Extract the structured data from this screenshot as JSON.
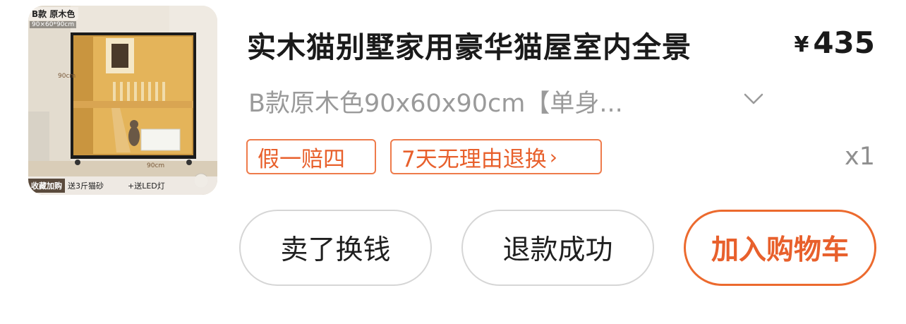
{
  "product": {
    "image": {
      "tag_top": "B款 原木色",
      "tag_size": "90×60*90cm",
      "dim_height": "90cm",
      "dim_width": "90cm",
      "fav_label": "收藏加购",
      "gift1": "送3斤猫砂",
      "gift2": "+送LED灯"
    },
    "title": "实木猫别墅家用豪华猫屋室内全景",
    "price_symbol": "¥",
    "price": "435",
    "variant": "B款原木色90x60x90cm【单身...",
    "badges": {
      "guarantee": "假一赔四",
      "return_policy": "7天无理由退换",
      "return_arrow": "›"
    },
    "quantity": "x1"
  },
  "actions": {
    "sell": "卖了换钱",
    "refund": "退款成功",
    "add_to_cart": "加入购物车"
  },
  "colors": {
    "accent": "#e8602c",
    "muted": "#9a9a9a"
  },
  "icons": {
    "variant_dropdown": "chevron-down-icon"
  }
}
